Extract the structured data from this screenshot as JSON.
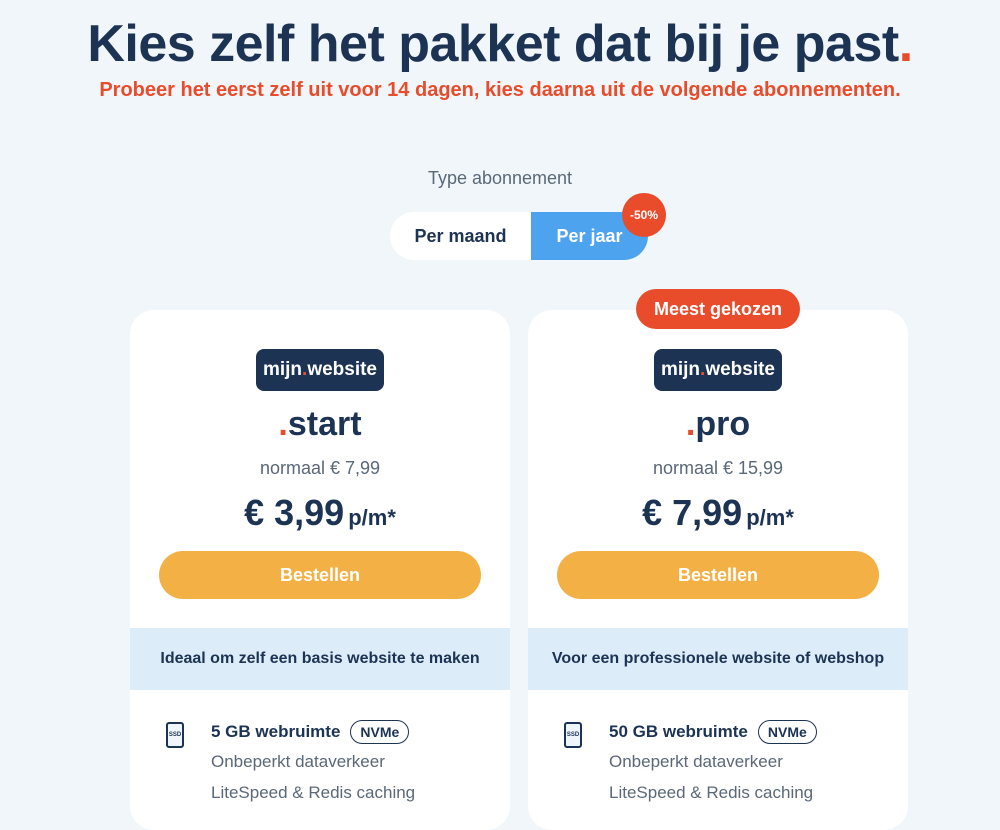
{
  "header": {
    "title": "Kies zelf het pakket dat bij je past",
    "title_dot": ".",
    "subtitle": "Probeer het eerst zelf uit voor 14 dagen, kies daarna uit de volgende abonnementen."
  },
  "billing": {
    "label": "Type abonnement",
    "monthly": "Per maand",
    "yearly": "Per jaar",
    "discount_badge": "-50%",
    "selected": "yearly"
  },
  "plans": [
    {
      "logo_left": "mijn",
      "logo_dot": ".",
      "logo_right": "website",
      "name_dot": ".",
      "name": "start",
      "normal_price": "normaal € 7,99",
      "price": "€ 3,99",
      "per": "p/m*",
      "order_label": "Bestellen",
      "tagline": "Ideaal om zelf een basis website te maken",
      "storage": "5 GB webruimte",
      "storage_badge": "NVMe",
      "ssd_icon_text": "SSD",
      "feature_1": "Onbeperkt dataverkeer",
      "feature_2": "LiteSpeed & Redis caching"
    },
    {
      "popular_badge": "Meest gekozen",
      "logo_left": "mijn",
      "logo_dot": ".",
      "logo_right": "website",
      "name_dot": ".",
      "name": "pro",
      "normal_price": "normaal € 15,99",
      "price": "€ 7,99",
      "per": "p/m*",
      "order_label": "Bestellen",
      "tagline": "Voor een professionele website of webshop",
      "storage": "50 GB webruimte",
      "storage_badge": "NVMe",
      "ssd_icon_text": "SSD",
      "feature_1": "Onbeperkt dataverkeer",
      "feature_2": "LiteSpeed & Redis caching"
    }
  ],
  "colors": {
    "navy": "#1c3354",
    "accent_red": "#e84c2b",
    "toggle_blue": "#4da3ee",
    "button_yellow": "#f3b045",
    "tagline_bg": "#dcedf9",
    "page_bg": "#f0f6fa"
  }
}
